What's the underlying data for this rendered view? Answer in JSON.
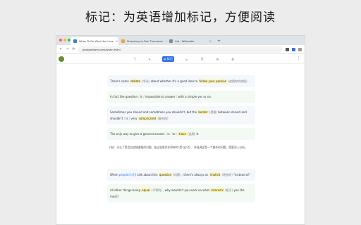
{
  "headline": "标记：为英语增加标记，方便阅读",
  "tabs": [
    {
      "label": "When To Do What You Love",
      "active": true,
      "color": "#3a7bd5"
    },
    {
      "label": "Stresstory to Dan Thompson",
      "active": false,
      "color": "#f2a33a"
    },
    {
      "label": "Cat - Wikipedia",
      "active": false,
      "color": "#888888"
    }
  ],
  "newtab": "+",
  "url": "paulgraham.com/when.html",
  "nav": {
    "back": "←",
    "forward": "→",
    "reload": "⟳"
  },
  "toolbar": {
    "tools": [
      "T",
      "✎",
      "▤ 标记",
      "▭",
      "文",
      "⚙",
      "⚙"
    ],
    "menu": "⋮"
  },
  "cards": {
    "c1": {
      "a": "There's some",
      "b": "debate",
      "c": "(争论)",
      "d": "about whether it's a good idea to",
      "e": "follow your passion",
      "f": "(追随你的热情)."
    },
    "c2": {
      "a": "In fact the question",
      "s1": "/",
      "b": "is",
      "s2": "/",
      "c": "impossible to answer",
      "s3": "/",
      "d": "with a simple yes or no."
    },
    "c3": {
      "a": "Sometimes you should and sometimes you shouldn't, but the",
      "b": "border",
      "c": "(界限)",
      "d": "between should and shouldn't",
      "s1": "/",
      "e": "is",
      "s2": "/",
      "f": "very",
      "g": "complicated",
      "h": "(复杂的)"
    },
    "c4": {
      "a": "The only way to give a general answer",
      "s1": "/",
      "b": "is",
      "s2": "/",
      "c": "to",
      "s3": "/",
      "d": "trace",
      "e": "(追溯)",
      "f": "it."
    },
    "note": "小结：讨论了是否应追随激情的问题，指出答案并非简单的\"是\"或\"否\"，并强调这是一个复杂的问题，需要深入分析。",
    "c5": {
      "a": "When",
      "b": "people(人们)",
      "c": "talk about this",
      "d": "question",
      "e": "(问题)",
      "f": ", there's always an",
      "g": "implicit",
      "h": "(隐含的)",
      "i": "\"instead of.\""
    },
    "c6": {
      "a": "All other things being",
      "b": "equal",
      "c": "(平等的)",
      "d": ", why wouldn't you work on what",
      "e": "interests",
      "f": "(吸引)",
      "g": "you the most?"
    }
  }
}
